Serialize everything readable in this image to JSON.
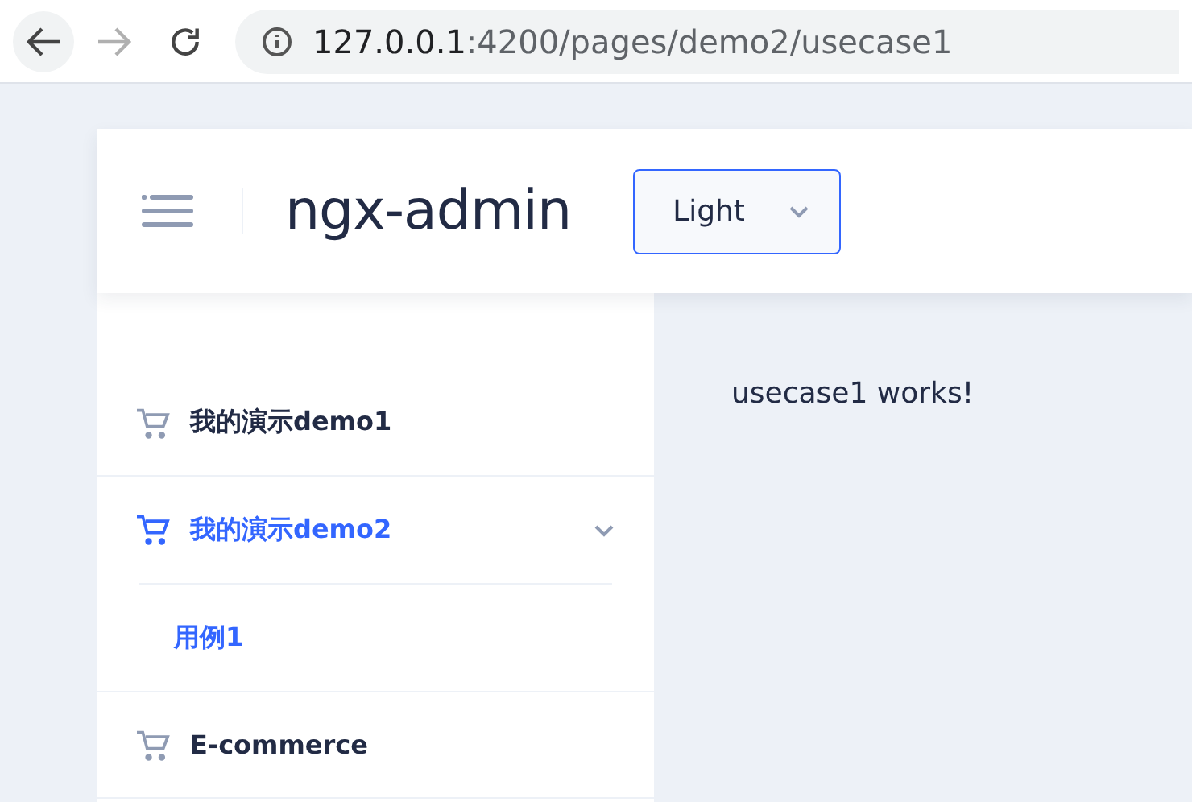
{
  "browser": {
    "back": {
      "disabled": false
    },
    "forward": {
      "disabled": true
    },
    "url_host": "127.0.0.1",
    "url_path": ":4200/pages/demo2/usecase1"
  },
  "header": {
    "title": "ngx-admin",
    "theme_select": {
      "value": "Light"
    }
  },
  "sidebar": {
    "items": [
      {
        "label": "我的演示demo1",
        "selected": false
      },
      {
        "label": "我的演示demo2",
        "selected": true,
        "expanded": true,
        "children": [
          {
            "label": "用例1",
            "selected": true
          }
        ]
      },
      {
        "label": "E-commerce",
        "selected": false
      }
    ]
  },
  "content": {
    "text": "usecase1 works!"
  }
}
